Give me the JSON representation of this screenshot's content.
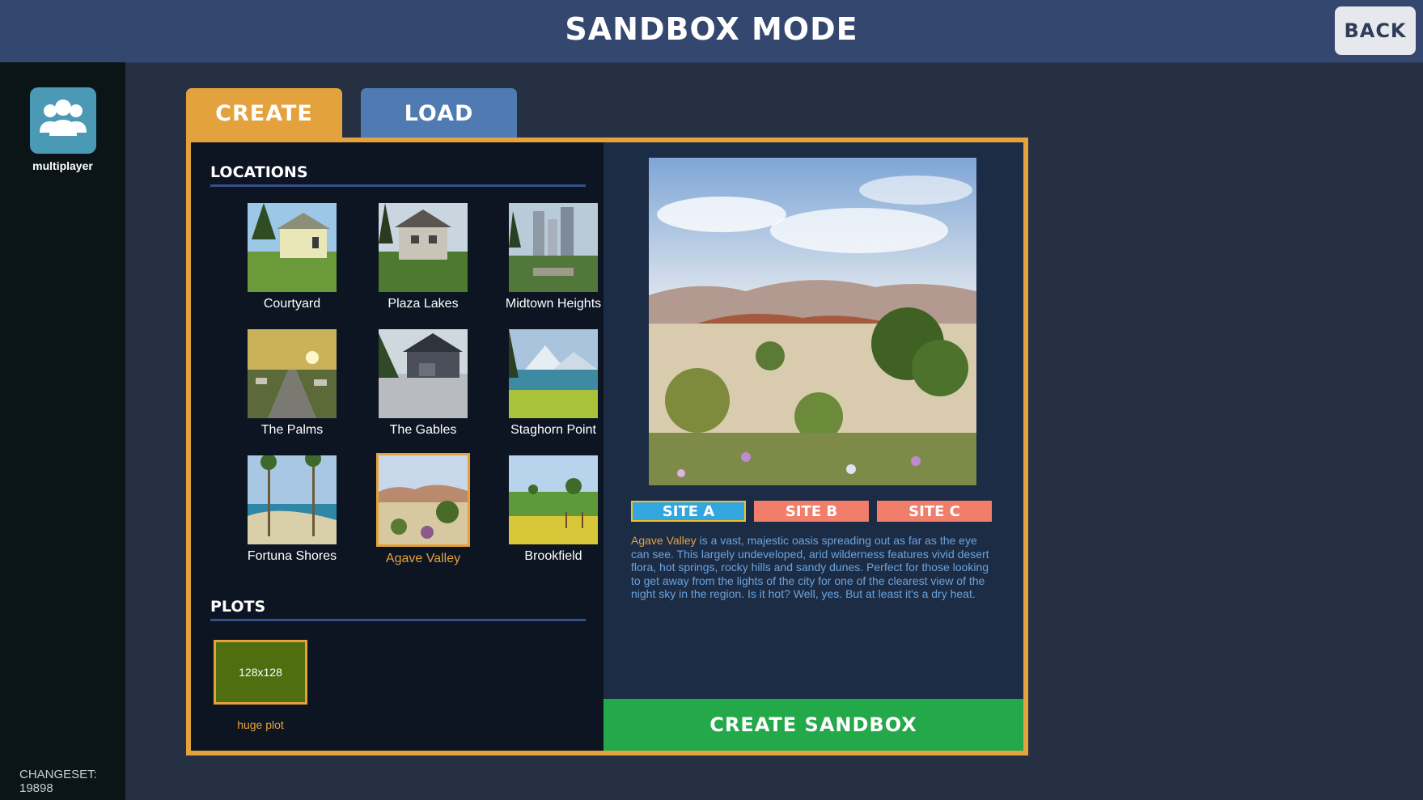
{
  "header": {
    "title": "SANDBOX MODE",
    "back_label": "BACK"
  },
  "sidebar": {
    "multiplayer_label": "multiplayer",
    "changeset": "CHANGESET: 19898"
  },
  "tabs": {
    "create": "CREATE",
    "load": "LOAD"
  },
  "locations": {
    "title": "LOCATIONS",
    "items": [
      {
        "name": "Courtyard"
      },
      {
        "name": "Plaza Lakes"
      },
      {
        "name": "Midtown Heights"
      },
      {
        "name": "The Palms"
      },
      {
        "name": "The Gables"
      },
      {
        "name": "Staghorn Point"
      },
      {
        "name": "Fortuna Shores"
      },
      {
        "name": "Agave Valley",
        "selected": true
      },
      {
        "name": "Brookfield"
      }
    ]
  },
  "plots": {
    "title": "PLOTS",
    "size": "128x128",
    "label": "huge plot"
  },
  "detail": {
    "sites": [
      "SITE A",
      "SITE B",
      "SITE C"
    ],
    "selected_site": "SITE A",
    "desc_name": "Agave Valley",
    "desc_text": " is a vast, majestic oasis spreading out as far as the eye can see. This largely undeveloped, arid wilderness features vivid desert flora, hot springs, rocky hills and sandy dunes. Perfect for those looking to get away from the lights of the city for one of the clearest view of the night sky in the region. Is it hot? Well, yes. But at least it's a dry heat.",
    "create_label": "CREATE SANDBOX"
  },
  "colors": {
    "accent": "#e3a23d",
    "tab_load": "#4f7bb2",
    "create_button": "#23a84a",
    "site_selected": "#33a5df",
    "site_unselected": "#f07e6b"
  }
}
